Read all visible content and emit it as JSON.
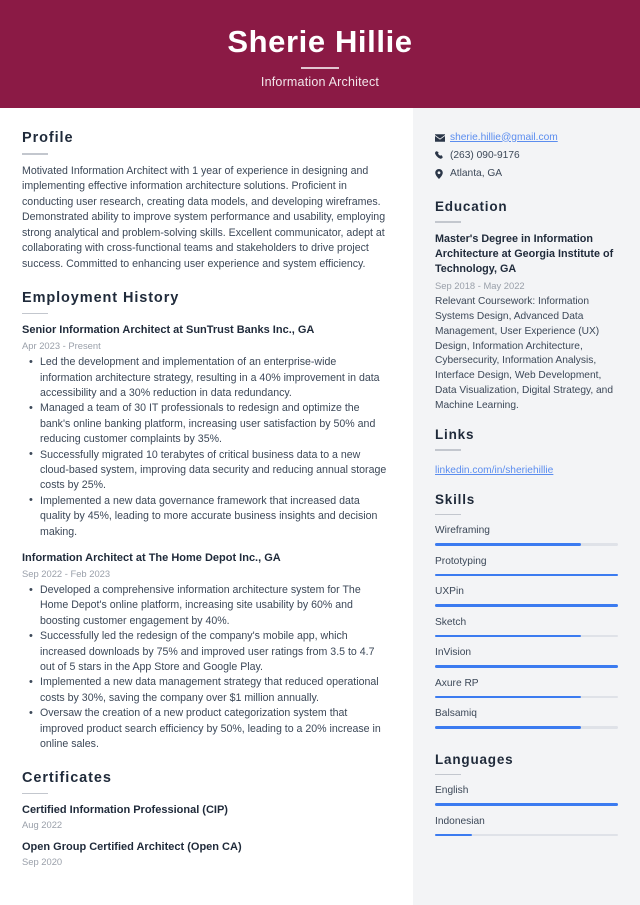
{
  "header": {
    "name": "Sherie Hillie",
    "job_title": "Information Architect",
    "bg_color": "#8b1a45"
  },
  "theme": {
    "accent_bar": "#3b7bf0",
    "link_color": "#5b8def",
    "sidebar_bg": "#f3f4f6",
    "heading_color": "#1f2a3a"
  },
  "main": {
    "profile": {
      "heading": "Profile",
      "text": "Motivated Information Architect with 1 year of experience in designing and implementing effective information architecture solutions. Proficient in conducting user research, creating data models, and developing wireframes. Demonstrated ability to improve system performance and usability, employing strong analytical and problem-solving skills. Excellent communicator, adept at collaborating with cross-functional teams and stakeholders to drive project success. Committed to enhancing user experience and system efficiency."
    },
    "employment": {
      "heading": "Employment History",
      "jobs": [
        {
          "title": "Senior Information Architect at SunTrust Banks Inc., GA",
          "date": "Apr 2023 - Present",
          "bullets": [
            "Led the development and implementation of an enterprise-wide information architecture strategy, resulting in a 40% improvement in data accessibility and a 30% reduction in data redundancy.",
            "Managed a team of 30 IT professionals to redesign and optimize the bank's online banking platform, increasing user satisfaction by 50% and reducing customer complaints by 35%.",
            "Successfully migrated 10 terabytes of critical business data to a new cloud-based system, improving data security and reducing annual storage costs by 25%.",
            "Implemented a new data governance framework that increased data quality by 45%, leading to more accurate business insights and decision making."
          ]
        },
        {
          "title": "Information Architect at The Home Depot Inc., GA",
          "date": "Sep 2022 - Feb 2023",
          "bullets": [
            "Developed a comprehensive information architecture system for The Home Depot's online platform, increasing site usability by 60% and boosting customer engagement by 40%.",
            "Successfully led the redesign of the company's mobile app, which increased downloads by 75% and improved user ratings from 3.5 to 4.7 out of 5 stars in the App Store and Google Play.",
            "Implemented a new data management strategy that reduced operational costs by 30%, saving the company over $1 million annually.",
            "Oversaw the creation of a new product categorization system that improved product search efficiency by 50%, leading to a 20% increase in online sales."
          ]
        }
      ]
    },
    "certificates": {
      "heading": "Certificates",
      "items": [
        {
          "name": "Certified Information Professional (CIP)",
          "date": "Aug 2022"
        },
        {
          "name": "Open Group Certified Architect (Open CA)",
          "date": "Sep 2020"
        }
      ]
    }
  },
  "sidebar": {
    "contact": [
      {
        "icon": "envelope-icon",
        "text": "sherie.hillie@gmail.com",
        "is_link": true
      },
      {
        "icon": "phone-icon",
        "text": "(263) 090-9176",
        "is_link": false
      },
      {
        "icon": "location-pin-icon",
        "text": "Atlanta, GA",
        "is_link": false
      }
    ],
    "education": {
      "heading": "Education",
      "degree": "Master's Degree in Information Architecture at Georgia Institute of Technology, GA",
      "date": "Sep 2018 - May 2022",
      "description": "Relevant Coursework: Information Systems Design, Advanced Data Management, User Experience (UX) Design, Information Architecture, Cybersecurity, Information Analysis, Interface Design, Web Development, Data Visualization, Digital Strategy, and Machine Learning."
    },
    "links": {
      "heading": "Links",
      "items": [
        {
          "label": "linkedin.com/in/sheriehillie"
        }
      ]
    },
    "skills": {
      "heading": "Skills",
      "items": [
        {
          "label": "Wireframing",
          "level": 80
        },
        {
          "label": "Prototyping",
          "level": 100
        },
        {
          "label": "UXPin",
          "level": 100
        },
        {
          "label": "Sketch",
          "level": 80
        },
        {
          "label": "InVision",
          "level": 100
        },
        {
          "label": "Axure RP",
          "level": 80
        },
        {
          "label": "Balsamiq",
          "level": 80
        }
      ]
    },
    "languages": {
      "heading": "Languages",
      "items": [
        {
          "label": "English",
          "level": 100
        },
        {
          "label": "Indonesian",
          "level": 20
        }
      ]
    }
  }
}
